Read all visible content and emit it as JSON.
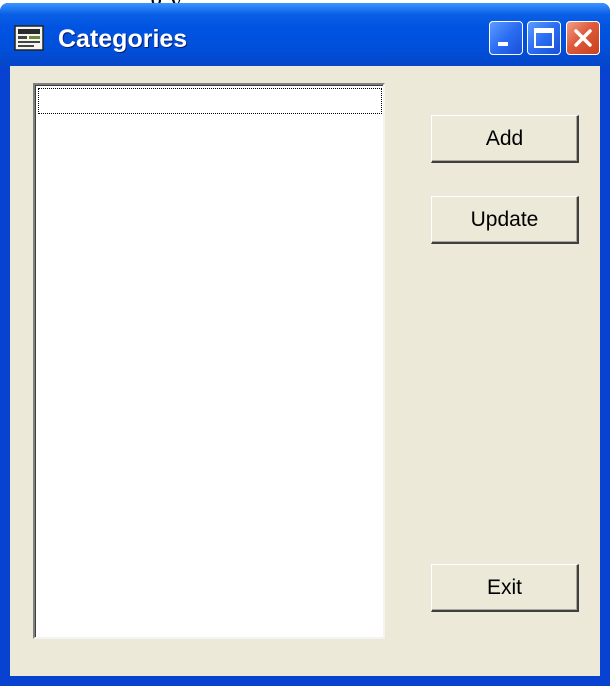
{
  "caption_fragment": "g y",
  "window": {
    "title": "Categories",
    "app_icon": "categories-app-icon",
    "controls": {
      "minimize": "minimize-icon",
      "maximize": "maximize-icon",
      "close": "close-icon"
    }
  },
  "list": {
    "items": []
  },
  "buttons": {
    "add": "Add",
    "update": "Update",
    "exit": "Exit"
  },
  "colors": {
    "titlebar": "#0053e1",
    "frame": "#0842d0",
    "client": "#ece9d8",
    "close_button": "#de5a3b"
  }
}
